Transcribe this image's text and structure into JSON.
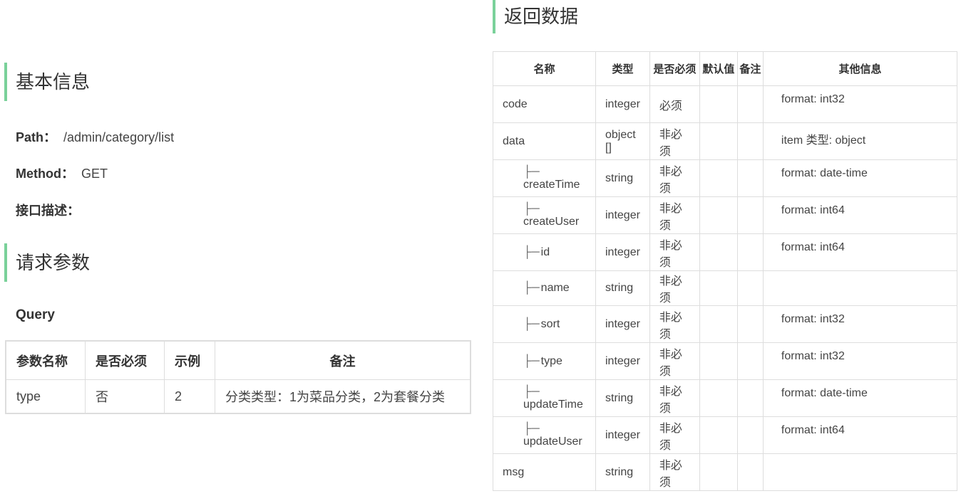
{
  "basic": {
    "heading": "基本信息",
    "path_label": "Path：",
    "path_value": "/admin/category/list",
    "method_label": "Method：",
    "method_value": "GET",
    "desc_label": "接口描述："
  },
  "request": {
    "heading": "请求参数",
    "query_title": "Query",
    "headers": [
      "参数名称",
      "是否必须",
      "示例",
      "备注"
    ],
    "rows": [
      {
        "name": "type",
        "required": "否",
        "example": "2",
        "note": "分类类型：1为菜品分类，2为套餐分类"
      }
    ]
  },
  "response": {
    "heading": "返回数据",
    "headers": [
      "名称",
      "类型",
      "是否必须",
      "默认值",
      "备注",
      "其他信息"
    ],
    "branch_glyph": "├─",
    "rows": [
      {
        "name": "code",
        "type": "integer",
        "required": "必须",
        "default": "",
        "note": "",
        "other": "format: int32",
        "child": false
      },
      {
        "name": "data",
        "type": "object []",
        "required": "非必须",
        "default": "",
        "note": "",
        "other": "item 类型: object",
        "child": false
      },
      {
        "name": "createTime",
        "type": "string",
        "required": "非必须",
        "default": "",
        "note": "",
        "other": "format: date-time",
        "child": true
      },
      {
        "name": "createUser",
        "type": "integer",
        "required": "非必须",
        "default": "",
        "note": "",
        "other": "format: int64",
        "child": true
      },
      {
        "name": "id",
        "type": "integer",
        "required": "非必须",
        "default": "",
        "note": "",
        "other": "format: int64",
        "child": true
      },
      {
        "name": "name",
        "type": "string",
        "required": "非必须",
        "default": "",
        "note": "",
        "other": "",
        "child": true
      },
      {
        "name": "sort",
        "type": "integer",
        "required": "非必须",
        "default": "",
        "note": "",
        "other": "format: int32",
        "child": true
      },
      {
        "name": "type",
        "type": "integer",
        "required": "非必须",
        "default": "",
        "note": "",
        "other": "format: int32",
        "child": true
      },
      {
        "name": "updateTime",
        "type": "string",
        "required": "非必须",
        "default": "",
        "note": "",
        "other": "format: date-time",
        "child": true
      },
      {
        "name": "updateUser",
        "type": "integer",
        "required": "非必须",
        "default": "",
        "note": "",
        "other": "format: int64",
        "child": true
      },
      {
        "name": "msg",
        "type": "string",
        "required": "非必须",
        "default": "",
        "note": "",
        "other": "",
        "child": false
      }
    ]
  }
}
